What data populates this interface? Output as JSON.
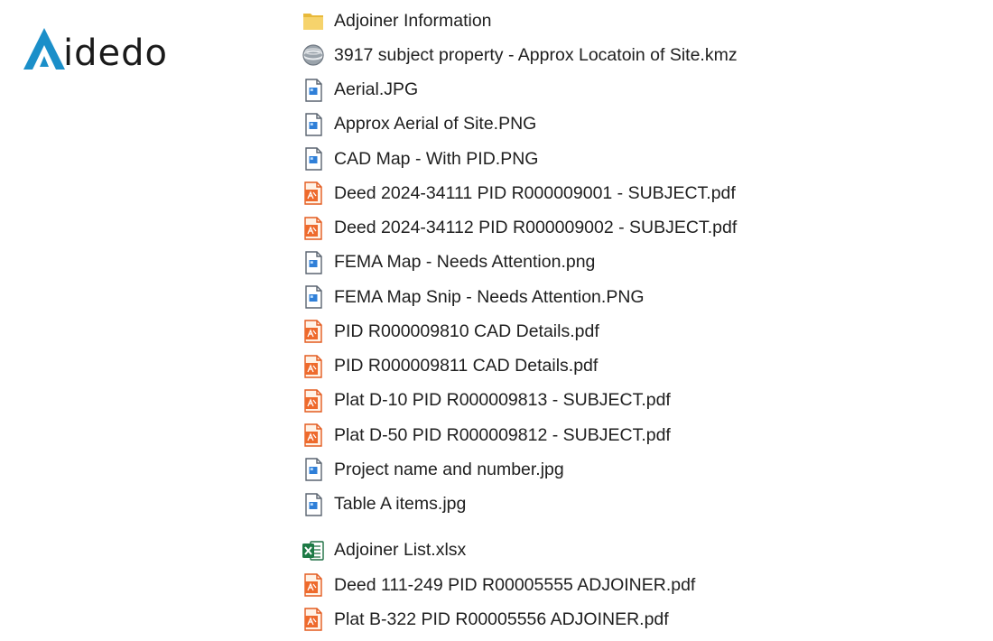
{
  "brand": {
    "name": "idedo",
    "accent": "#1b8fc9"
  },
  "files": [
    {
      "name": "Adjoiner Information",
      "icon": "folder-icon"
    },
    {
      "name": "3917 subject property - Approx Locatoin of Site.kmz",
      "icon": "kmz-globe-icon"
    },
    {
      "name": "Aerial.JPG",
      "icon": "image-file-icon"
    },
    {
      "name": "Approx Aerial of Site.PNG",
      "icon": "image-file-icon"
    },
    {
      "name": "CAD Map - With PID.PNG",
      "icon": "image-file-icon"
    },
    {
      "name": "Deed 2024-34111 PID R000009001 - SUBJECT.pdf",
      "icon": "pdf-file-icon"
    },
    {
      "name": "Deed 2024-34112 PID R000009002 - SUBJECT.pdf",
      "icon": "pdf-file-icon"
    },
    {
      "name": "FEMA Map - Needs Attention.png",
      "icon": "image-file-icon"
    },
    {
      "name": "FEMA Map Snip - Needs Attention.PNG",
      "icon": "image-file-icon"
    },
    {
      "name": "PID R000009810 CAD Details.pdf",
      "icon": "pdf-file-icon"
    },
    {
      "name": "PID R000009811  CAD Details.pdf",
      "icon": "pdf-file-icon"
    },
    {
      "name": "Plat D-10 PID R000009813 - SUBJECT.pdf",
      "icon": "pdf-file-icon"
    },
    {
      "name": "Plat D-50 PID R000009812 - SUBJECT.pdf",
      "icon": "pdf-file-icon"
    },
    {
      "name": "Project name and number.jpg",
      "icon": "image-file-icon"
    },
    {
      "name": "Table A items.jpg",
      "icon": "image-file-icon"
    },
    {
      "name": "Adjoiner List.xlsx",
      "icon": "excel-file-icon",
      "group_start": true
    },
    {
      "name": "Deed 111-249 PID R00005555 ADJOINER.pdf",
      "icon": "pdf-file-icon"
    },
    {
      "name": "Plat B-322 PID R00005556 ADJOINER.pdf",
      "icon": "pdf-file-icon"
    }
  ]
}
